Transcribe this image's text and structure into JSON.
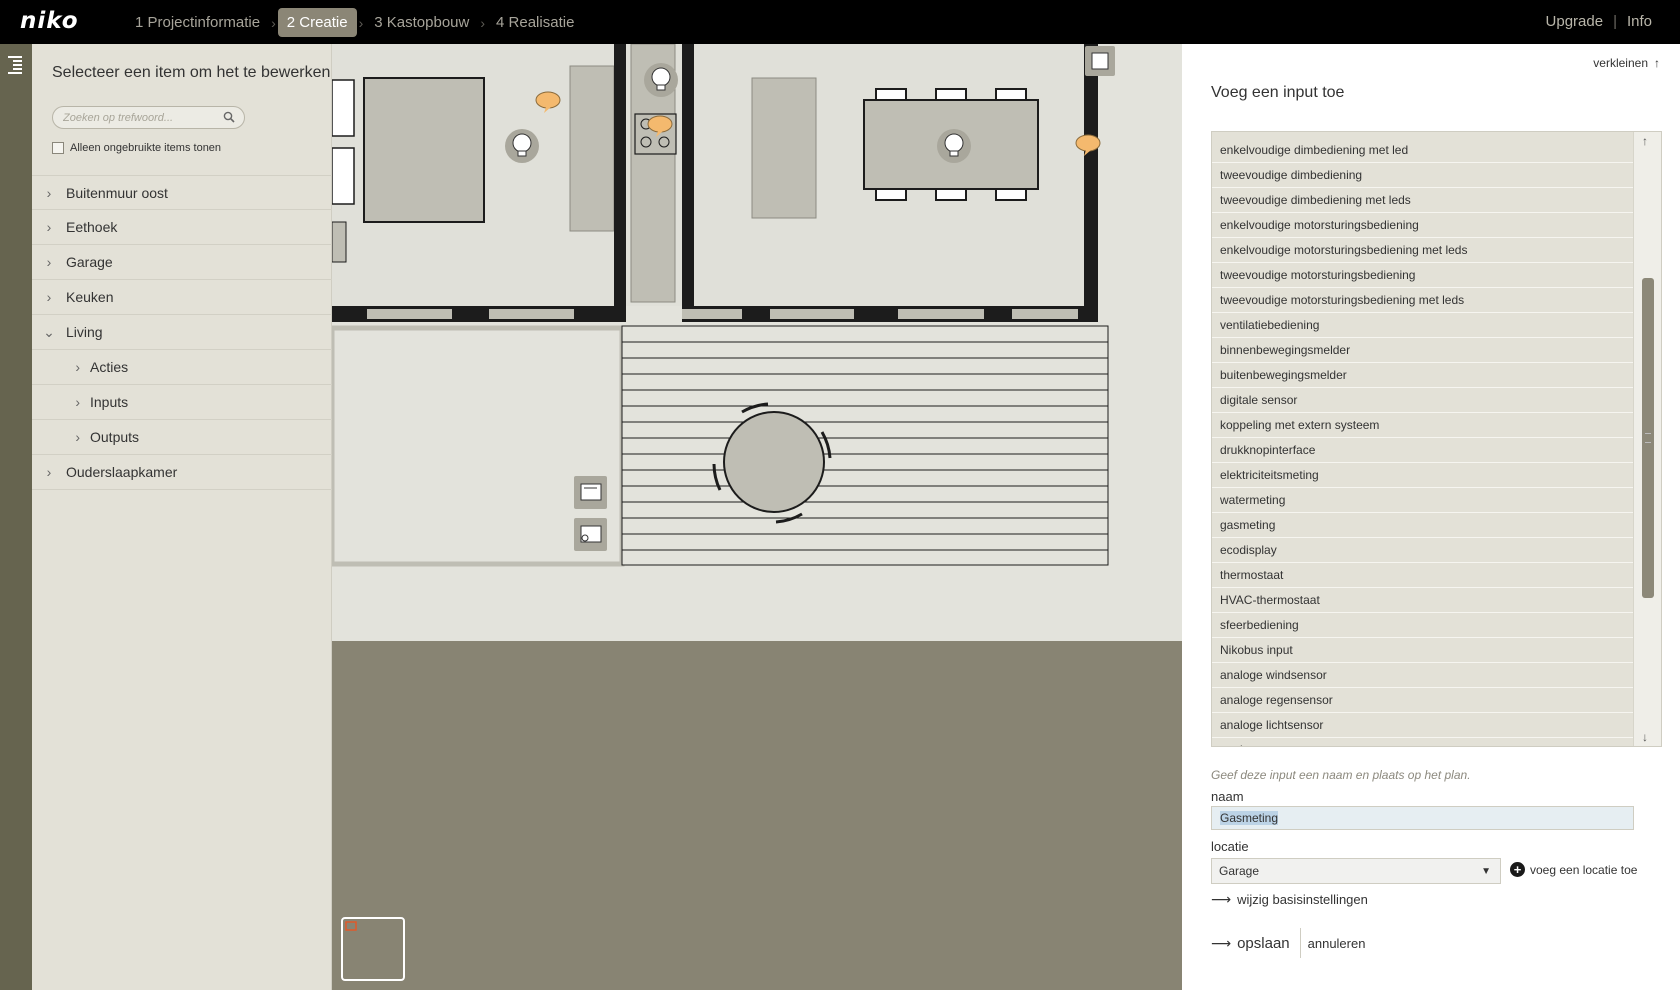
{
  "brand": {
    "logo": "niko"
  },
  "steps": [
    {
      "label": "1 Projectinformatie",
      "active": false
    },
    {
      "label": "2 Creatie",
      "active": true
    },
    {
      "label": "3 Kastopbouw",
      "active": false
    },
    {
      "label": "4 Realisatie",
      "active": false
    }
  ],
  "toplinks": {
    "upgrade": "Upgrade",
    "separator": "|",
    "info": "Info"
  },
  "sidebar": {
    "title": "Selecteer een item om het te bewerken",
    "search_placeholder": "Zoeken op trefwoord...",
    "checkbox_label": "Alleen ongebruikte items tonen",
    "tree": [
      {
        "label": "Buitenmuur oost",
        "expanded": false
      },
      {
        "label": "Eethoek",
        "expanded": false
      },
      {
        "label": "Garage",
        "expanded": false
      },
      {
        "label": "Keuken",
        "expanded": false
      },
      {
        "label": "Living",
        "expanded": true,
        "children": [
          "Acties",
          "Inputs",
          "Outputs"
        ]
      },
      {
        "label": "Ouderslaapkamer",
        "expanded": false
      }
    ]
  },
  "panel": {
    "shrink_label": "verkleinen",
    "title": "Voeg een input toe",
    "options": [
      "enkelvoudige dimbediening met led",
      "tweevoudige dimbediening",
      "tweevoudige dimbediening met leds",
      "enkelvoudige motorsturingsbediening",
      "enkelvoudige motorsturingsbediening met leds",
      "tweevoudige motorsturingsbediening",
      "tweevoudige motorsturingsbediening met leds",
      "ventilatiebediening",
      "binnenbewegingsmelder",
      "buitenbewegingsmelder",
      "digitale sensor",
      "koppeling met extern systeem",
      "drukknopinterface",
      "elektriciteitsmeting",
      "watermeting",
      "gasmeting",
      "ecodisplay",
      "thermostaat",
      "HVAC-thermostaat",
      "sfeerbediening",
      "Nikobus input",
      "analoge windsensor",
      "analoge regensensor",
      "analoge lichtsensor",
      "analoge temperatuursensor"
    ],
    "hint": "Geef deze input een naam en plaats op het plan.",
    "naam_label": "naam",
    "naam_value": "Gasmeting",
    "locatie_label": "locatie",
    "locatie_value": "Garage",
    "add_location": "voeg een locatie toe",
    "wijzig_link": "wijzig basisinstellingen",
    "save": "opslaan",
    "cancel": "annuleren"
  },
  "colors": {
    "topbar": "#000000",
    "active_step": "#8b8676",
    "sidebar_bg": "#e3e1d7",
    "left_strip": "#66644f",
    "plan_bg": "#888473",
    "plan_floor": "#e3e3dc",
    "wall": "#1c1c1c",
    "furniture": "#bfbeb4",
    "balloon": "#f4b96e"
  },
  "icons": {
    "menu": "list-menu-icon",
    "search": "search-icon",
    "expand": "chevron-right-icon",
    "collapse": "chevron-down-icon",
    "shrink": "arrow-up-icon",
    "scroll_up": "arrow-up-icon",
    "scroll_down": "arrow-down-icon",
    "add": "plus-circle-icon",
    "link": "arrow-right-icon"
  }
}
